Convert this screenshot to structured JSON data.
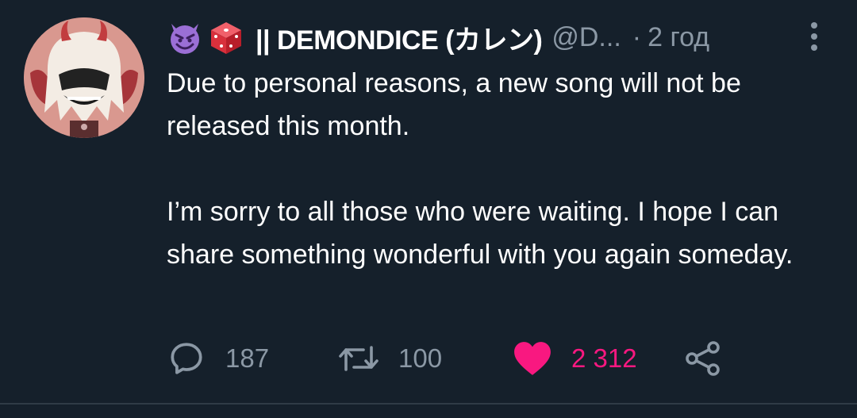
{
  "tweet": {
    "display_name": "|| DEMONDICE (カレン)",
    "handle": "@D...",
    "dot": "·",
    "time": "2 год",
    "emoji": [
      "smiling-imp-emoji",
      "game-die-emoji"
    ],
    "paragraphs": [
      "Due to personal reasons, a new song will not be released this month.",
      "I’m sorry to all those who were waiting. I hope I can share something wonderful with you again someday."
    ]
  },
  "actions": {
    "replies": "187",
    "retweets": "100",
    "likes": "2 312",
    "liked": true
  },
  "colors": {
    "background": "#15202b",
    "secondary_text": "#8b98a5",
    "like": "#f91880"
  }
}
